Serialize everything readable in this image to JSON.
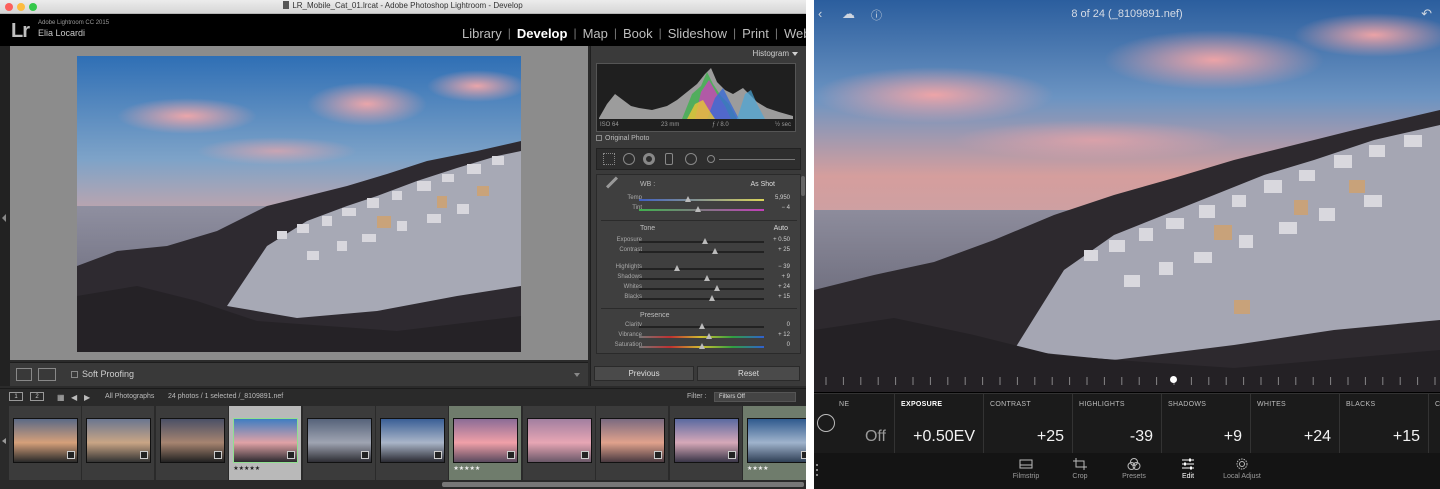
{
  "window": {
    "title": "LR_Mobile_Cat_01.lrcat - Adobe Photoshop Lightroom - Develop"
  },
  "identity": {
    "logo": "Lr",
    "app_name": "Adobe Lightroom CC 2015",
    "user": "Elia Locardi"
  },
  "modules": [
    {
      "label": "Library",
      "active": false
    },
    {
      "label": "Develop",
      "active": true
    },
    {
      "label": "Map",
      "active": false
    },
    {
      "label": "Book",
      "active": false
    },
    {
      "label": "Slideshow",
      "active": false
    },
    {
      "label": "Print",
      "active": false
    },
    {
      "label": "Web",
      "active": false
    }
  ],
  "toolbar": {
    "soft_proofing": "Soft Proofing"
  },
  "histogram": {
    "title": "Histogram",
    "iso": "ISO 64",
    "focal": "23 mm",
    "aperture": "ƒ / 8.0",
    "shutter": "½ sec",
    "original_photo": "Original Photo"
  },
  "basic": {
    "wb_label": "WB :",
    "wb_value": "As Shot",
    "temp": {
      "label": "Temp",
      "value": "5,950"
    },
    "tint": {
      "label": "Tint",
      "value": "− 4"
    },
    "tone_label": "Tone",
    "auto_label": "Auto",
    "exposure": {
      "label": "Exposure",
      "value": "+ 0.50"
    },
    "contrast": {
      "label": "Contrast",
      "value": "+ 25"
    },
    "highlights": {
      "label": "Highlights",
      "value": "− 39"
    },
    "shadows": {
      "label": "Shadows",
      "value": "+ 9"
    },
    "whites": {
      "label": "Whites",
      "value": "+ 24"
    },
    "blacks": {
      "label": "Blacks",
      "value": "+ 15"
    },
    "presence_label": "Presence",
    "clarity": {
      "label": "Clarity",
      "value": "0"
    },
    "vibrance": {
      "label": "Vibrance",
      "value": "+ 12"
    },
    "saturation": {
      "label": "Saturation",
      "value": "0"
    }
  },
  "panel_buttons": {
    "previous": "Previous",
    "reset": "Reset"
  },
  "filmbar": {
    "page1": "1",
    "page2": "2",
    "source": "All Photographs",
    "status": "24 photos / 1 selected /_8109891.nef",
    "filter_label": "Filter :",
    "filter_value": "Filters Off"
  },
  "filmstrip": [
    {
      "stars": "",
      "selected": false,
      "tint": false
    },
    {
      "stars": "",
      "selected": false,
      "tint": false
    },
    {
      "stars": "",
      "selected": false,
      "tint": false
    },
    {
      "stars": "★★★★★",
      "selected": true,
      "tint": false
    },
    {
      "stars": "",
      "selected": false,
      "tint": false
    },
    {
      "stars": "",
      "selected": false,
      "tint": false
    },
    {
      "stars": "★★★★★",
      "selected": false,
      "tint": true
    },
    {
      "stars": "",
      "selected": false,
      "tint": false
    },
    {
      "stars": "",
      "selected": false,
      "tint": false
    },
    {
      "stars": "",
      "selected": false,
      "tint": false
    },
    {
      "stars": "★★★★",
      "selected": false,
      "tint": true
    }
  ],
  "mobile": {
    "counter": "8 of 24 (_8109891.nef)",
    "adjustments": [
      {
        "name": "NE",
        "value": "Off",
        "dim": true
      },
      {
        "name": "EXPOSURE",
        "value": "+0.50EV",
        "active": true
      },
      {
        "name": "CONTRAST",
        "value": "+25"
      },
      {
        "name": "HIGHLIGHTS",
        "value": "-39"
      },
      {
        "name": "SHADOWS",
        "value": "+9"
      },
      {
        "name": "WHITES",
        "value": "+24"
      },
      {
        "name": "BLACKS",
        "value": "+15"
      },
      {
        "name": "C",
        "value": ""
      }
    ],
    "nav": [
      {
        "label": "Filmstrip",
        "icon": "filmstrip-icon"
      },
      {
        "label": "Crop",
        "icon": "crop-icon"
      },
      {
        "label": "Presets",
        "icon": "presets-icon"
      },
      {
        "label": "Edit",
        "icon": "edit-icon",
        "active": true
      },
      {
        "label": "Local Adjust",
        "icon": "local-adjust-icon"
      }
    ]
  },
  "colors": {
    "accent": "#ffffff",
    "panel": "#3a3a3a",
    "selection": "#8fe08f"
  }
}
